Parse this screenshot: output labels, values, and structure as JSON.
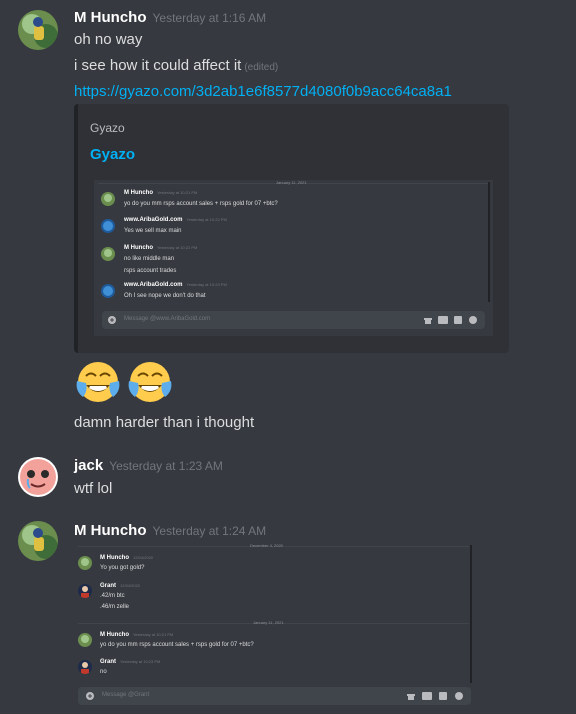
{
  "messages": [
    {
      "author": "M Huncho",
      "timestamp": "Yesterday at 1:16 AM",
      "lines": [
        "oh no way",
        "i see how it could affect it"
      ],
      "edited_label": "(edited)",
      "link": "https://gyazo.com/3d2ab1e6f8577d4080f0b9acc64ca8a1",
      "embed": {
        "provider": "Gyazo",
        "title": "Gyazo",
        "screenshot": {
          "date_divider": "January 11, 2021",
          "messages": [
            {
              "author": "M Huncho",
              "timestamp": "Yesterday at 10:21 PM",
              "lines": [
                "yo do you mm rsps account sales + rsps gold for 07 +btc?"
              ]
            },
            {
              "author": "www.AribaGold.com",
              "timestamp": "Yesterday at 10:22 PM",
              "lines": [
                "Yes we sell max main"
              ]
            },
            {
              "author": "M Huncho",
              "timestamp": "Yesterday at 10:22 PM",
              "lines": [
                "no like middle man",
                "rsps account trades"
              ]
            },
            {
              "author": "www.AribaGold.com",
              "timestamp": "Yesterday at 10:23 PM",
              "lines": [
                "Oh I see nope we don't do that"
              ]
            }
          ],
          "input_placeholder": "Message @www.AribaGold.com"
        }
      },
      "emojis": [
        "joy-emoji",
        "joy-emoji"
      ],
      "after_emoji_line": "damn harder than i thought"
    },
    {
      "author": "jack",
      "timestamp": "Yesterday at 1:23 AM",
      "lines": [
        "wtf lol"
      ]
    },
    {
      "author": "M Huncho",
      "timestamp": "Yesterday at 1:24 AM",
      "screenshot": {
        "date_divider_1": "December 4, 2020",
        "date_divider_2": "January 11, 2021",
        "messages": [
          {
            "author": "M Huncho",
            "timestamp": "12/04/2020",
            "lines": [
              "Yo you got gold?"
            ]
          },
          {
            "author": "Grant",
            "timestamp": "12/04/2020",
            "lines": [
              ".42/m btc",
              ".46/m zelle"
            ]
          },
          {
            "author": "M Huncho",
            "timestamp": "Yesterday at 10:21 PM",
            "lines": [
              "yo do you mm rsps account sales + rsps gold for 07 +btc?"
            ]
          },
          {
            "author": "Grant",
            "timestamp": "Yesterday at 10:23 PM",
            "lines": [
              "no"
            ]
          }
        ],
        "input_placeholder": "Message @Grant"
      }
    }
  ],
  "colors": {
    "background": "#36393f",
    "embed_bg": "#2f3136",
    "link": "#00b0f4",
    "timestamp": "#72767d",
    "text": "#dcddde"
  }
}
